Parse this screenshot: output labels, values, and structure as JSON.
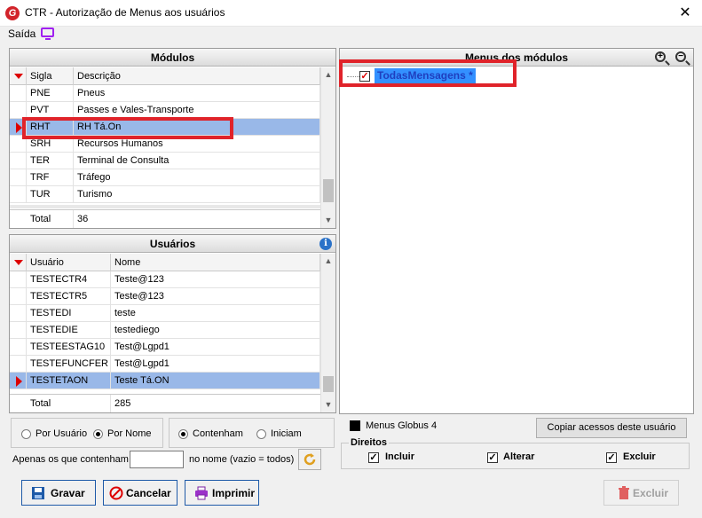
{
  "window": {
    "title": "CTR - Autorização de Menus aos usuários",
    "app_icon_letter": "G",
    "close_glyph": "✕"
  },
  "menubar": {
    "saida_label": "Saída"
  },
  "modulos": {
    "title": "Módulos",
    "columns": [
      "Sigla",
      "Descrição"
    ],
    "rows": [
      {
        "sigla": "PNE",
        "descricao": "Pneus"
      },
      {
        "sigla": "PVT",
        "descricao": "Passes e Vales-Transporte"
      },
      {
        "sigla": "RHT",
        "descricao": "RH Tá.On",
        "selected": true
      },
      {
        "sigla": "SRH",
        "descricao": "Recursos Humanos"
      },
      {
        "sigla": "TER",
        "descricao": "Terminal de Consulta"
      },
      {
        "sigla": "TRF",
        "descricao": "Tráfego"
      },
      {
        "sigla": "TUR",
        "descricao": "Turismo"
      }
    ],
    "total_label": "Total",
    "total_value": "36"
  },
  "usuarios": {
    "title": "Usuários",
    "columns": [
      "Usuário",
      "Nome"
    ],
    "rows": [
      {
        "usuario": "TESTECTR4",
        "nome": "Teste@123"
      },
      {
        "usuario": "TESTECTR5",
        "nome": "Teste@123"
      },
      {
        "usuario": "TESTEDI",
        "nome": "teste"
      },
      {
        "usuario": "TESTEDIE",
        "nome": "testediego"
      },
      {
        "usuario": "TESTEESTAG10",
        "nome": "Test@Lgpd1"
      },
      {
        "usuario": "TESTEFUNCFER",
        "nome": "Test@Lgpd1"
      },
      {
        "usuario": "TESTETAON",
        "nome": "Teste Tá.ON",
        "selected": true
      }
    ],
    "total_label": "Total",
    "total_value": "285"
  },
  "menus": {
    "title": "Menus dos módulos",
    "tree_item": "TodasMensagens *",
    "tree_item_checked": true
  },
  "filter": {
    "por_usuario": "Por Usuário",
    "por_nome": "Por Nome",
    "selected_mode": "Por Nome",
    "contenham": "Contenham",
    "iniciam": "Iniciam",
    "selected_match": "Contenham",
    "apenas_label": "Apenas os que contenham",
    "apenas_value": "",
    "no_nome_label": "no nome (vazio = todos)"
  },
  "legend": {
    "label": "Menus Globus 4",
    "color": "#000000"
  },
  "copiar_button": "Copiar acessos deste usuário",
  "direitos": {
    "title": "Direitos",
    "incluir": "Incluir",
    "alterar": "Alterar",
    "excluir": "Excluir",
    "incluir_checked": true,
    "alterar_checked": true,
    "excluir_checked": true,
    "check_glyph": "✓"
  },
  "buttons": {
    "gravar": "Gravar",
    "cancelar": "Cancelar",
    "imprimir": "Imprimir",
    "excluir": "Excluir"
  },
  "colors": {
    "selection": "#99b8e8",
    "highlight_box": "#e0232a",
    "accent_red": "#d00000",
    "tree_text": "#1f3fbf"
  }
}
